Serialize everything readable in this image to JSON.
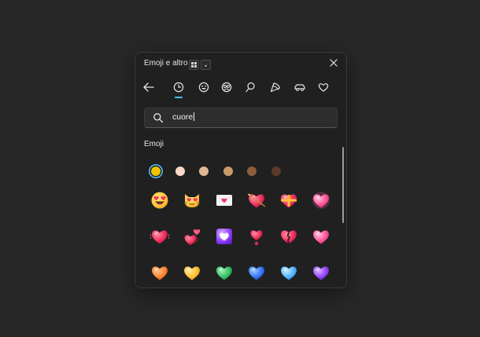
{
  "panel": {
    "title": "Emoji e altro",
    "close_icon": "close-icon"
  },
  "tabs": [
    {
      "name": "back",
      "icon": "arrow-left-icon"
    },
    {
      "name": "recent",
      "icon": "clock-icon",
      "selected": true
    },
    {
      "name": "smileys",
      "icon": "smiley-icon"
    },
    {
      "name": "people",
      "icon": "people-icon"
    },
    {
      "name": "celebration",
      "icon": "balloon-icon"
    },
    {
      "name": "food",
      "icon": "pizza-icon"
    },
    {
      "name": "travel",
      "icon": "car-icon"
    },
    {
      "name": "symbols",
      "icon": "heart-outline-icon"
    }
  ],
  "search": {
    "value": "cuore"
  },
  "section": {
    "label": "Emoji"
  },
  "skin_tones": [
    "#f2c100",
    "#f7d9c4",
    "#e0b896",
    "#c79a6b",
    "#8d5e3c",
    "#5a3a28"
  ],
  "emojis": [
    [
      "smiling-face-with-heart-eyes",
      "cat-with-heart-eyes",
      "love-letter",
      "heart-with-arrow",
      "heart-with-ribbon",
      "glowing-heart"
    ],
    [
      "beating-heart",
      "revolving-hearts",
      "heart-decoration",
      "heart-exclamation",
      "broken-heart",
      "growing-heart"
    ],
    [
      "orange-heart",
      "yellow-heart",
      "green-heart",
      "blue-heart",
      "light-blue-heart",
      "purple-heart"
    ]
  ],
  "colors": {
    "accent": "#4cc2ff",
    "background": "#272727",
    "panel": "#202020"
  }
}
